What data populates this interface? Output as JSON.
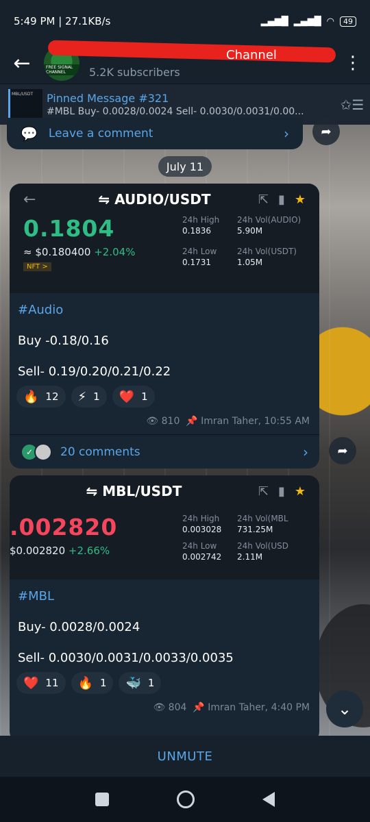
{
  "status_bar": {
    "time_speed": "5:49 PM | 27.1KB/s",
    "battery": "49"
  },
  "header": {
    "channel_name": "Channel",
    "subscribers": "5.2K subscribers",
    "avatar_text": "FREE SIGNAL CHANNEL"
  },
  "pinned": {
    "thumb_label": "MBL/USDT",
    "title": "Pinned Message #321",
    "subtitle": "#MBL    Buy- 0.0028/0.0024    Sell- 0.0030/0.0031/0.00..."
  },
  "prev_message": {
    "comment_label": "Leave a comment"
  },
  "date_chip": "July 11",
  "messages": [
    {
      "ticker": {
        "pair": "AUDIO/USDT",
        "price": "0.1804",
        "fiat": "≈ $0.180400",
        "change": "+2.04%",
        "nft_badge": "NFT >",
        "high_label": "24h High",
        "high": "0.1836",
        "vol1_label": "24h Vol(AUDIO)",
        "vol1": "5.90M",
        "low_label": "24h Low",
        "low": "0.1731",
        "vol2_label": "24h Vol(USDT)",
        "vol2": "1.05M"
      },
      "hashtag": "#Audio",
      "buy": "Buy -0.18/0.16",
      "sell": "Sell- 0.19/0.20/0.21/0.22",
      "reactions": [
        {
          "icon": "🔥",
          "count": "12"
        },
        {
          "icon": "⚡",
          "count": "1"
        },
        {
          "icon": "❤️",
          "count": "1"
        }
      ],
      "views": "810",
      "author_time": "Imran Taher, 10:55 AM",
      "comments": "20 comments"
    },
    {
      "ticker": {
        "pair": "MBL/USDT",
        "price": ".002820",
        "fiat": "$0.002820",
        "change": "+2.66%",
        "high_label": "24h High",
        "high": "0.003028",
        "vol1_label": "24h Vol(MBL",
        "vol1": "731.25M",
        "low_label": "24h Low",
        "low": "0.002742",
        "vol2_label": "24h Vol(USD",
        "vol2": "2.11M"
      },
      "hashtag": "#MBL",
      "buy": "Buy- 0.0028/0.0024",
      "sell": "Sell- 0.0030/0.0031/0.0033/0.0035",
      "reactions": [
        {
          "icon": "❤️",
          "count": "11"
        },
        {
          "icon": "🔥",
          "count": "1"
        },
        {
          "icon": "🐳",
          "count": "1"
        }
      ],
      "views": "804",
      "author_time": "Imran Taher, 4:40 PM"
    }
  ],
  "unmute_label": "UNMUTE"
}
